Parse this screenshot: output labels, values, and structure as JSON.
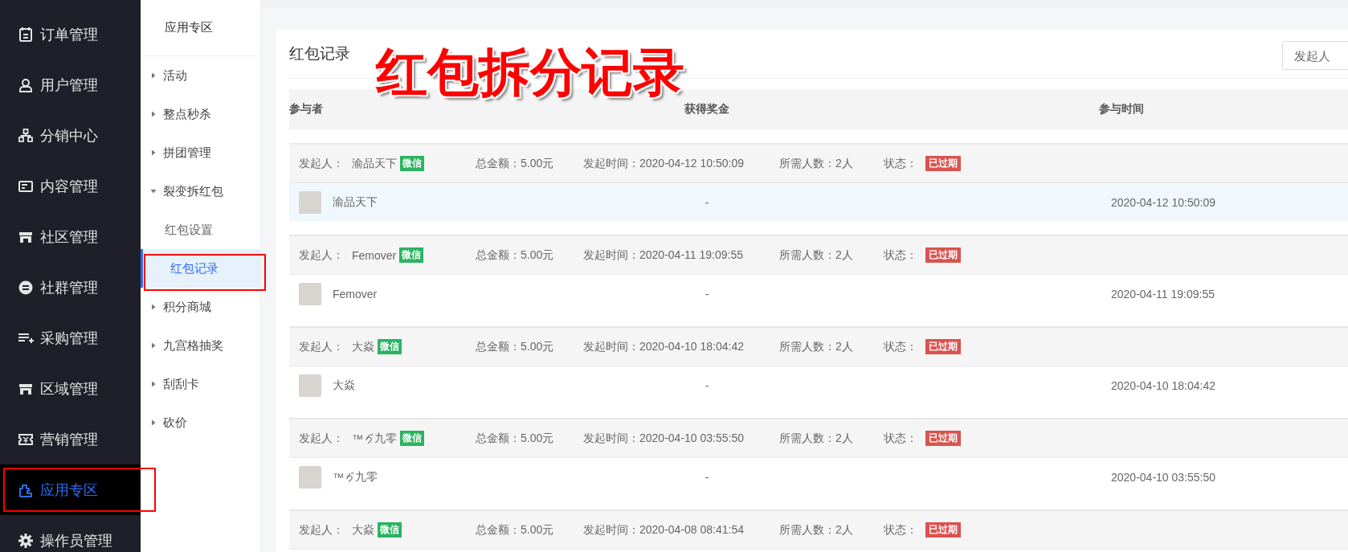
{
  "sidebar": {
    "items": [
      {
        "label": "订单管理",
        "selected": false,
        "callout": false
      },
      {
        "label": "用户管理",
        "selected": false,
        "callout": false
      },
      {
        "label": "分销中心",
        "selected": false,
        "callout": false
      },
      {
        "label": "内容管理",
        "selected": false,
        "callout": false
      },
      {
        "label": "社区管理",
        "selected": false,
        "callout": false
      },
      {
        "label": "社群管理",
        "selected": false,
        "callout": false
      },
      {
        "label": "采购管理",
        "selected": false,
        "callout": false
      },
      {
        "label": "区域管理",
        "selected": false,
        "callout": false
      },
      {
        "label": "营销管理",
        "selected": false,
        "callout": false
      },
      {
        "label": "应用专区",
        "selected": true,
        "callout": true
      },
      {
        "label": "操作员管理",
        "selected": false,
        "callout": false
      }
    ]
  },
  "submenu": {
    "title": "应用专区",
    "items": [
      {
        "label": "活动",
        "expanded": false
      },
      {
        "label": "整点秒杀",
        "expanded": false
      },
      {
        "label": "拼团管理",
        "expanded": false
      },
      {
        "label": "裂变拆红包",
        "expanded": true,
        "children": [
          {
            "label": "红包设置",
            "selected": false,
            "callout": false
          },
          {
            "label": "红包记录",
            "selected": true,
            "callout": true
          }
        ]
      },
      {
        "label": "积分商城",
        "expanded": false
      },
      {
        "label": "九宫格抽奖",
        "expanded": false
      },
      {
        "label": "刮刮卡",
        "expanded": false
      },
      {
        "label": "砍价",
        "expanded": false
      }
    ]
  },
  "page": {
    "title": "红包记录",
    "annotation": "红包拆分记录",
    "search": {
      "placeholder": "发起人"
    }
  },
  "table": {
    "columns": [
      "参与者",
      "获得奖金",
      "参与时间"
    ],
    "groups": [
      {
        "initiator_label": "发起人：",
        "initiator": "渝品天下",
        "channel": "微信",
        "total": "总金额：5.00元",
        "started": "发起时间：2020-04-12 10:50:09",
        "required": "所需人数：2人",
        "status_label": "状态：",
        "status": "已过期",
        "participants": [
          {
            "name": "渝品天下",
            "prize": "-",
            "time": "2020-04-12 10:50:09",
            "highlighted": true
          }
        ]
      },
      {
        "initiator_label": "发起人：",
        "initiator": "Femover",
        "channel": "微信",
        "total": "总金额：5.00元",
        "started": "发起时间：2020-04-11 19:09:55",
        "required": "所需人数：2人",
        "status_label": "状态：",
        "status": "已过期",
        "participants": [
          {
            "name": "Femover",
            "prize": "-",
            "time": "2020-04-11 19:09:55",
            "highlighted": false
          }
        ]
      },
      {
        "initiator_label": "发起人：",
        "initiator": "大焱",
        "channel": "微信",
        "total": "总金额：5.00元",
        "started": "发起时间：2020-04-10 18:04:42",
        "required": "所需人数：2人",
        "status_label": "状态：",
        "status": "已过期",
        "participants": [
          {
            "name": "大焱",
            "prize": "-",
            "time": "2020-04-10 18:04:42",
            "highlighted": false
          }
        ]
      },
      {
        "initiator_label": "发起人：",
        "initiator_segments": [
          {
            "kind": "text",
            "text": "™"
          },
          {
            "kind": "glyph"
          },
          {
            "kind": "text",
            "text": "九零"
          }
        ],
        "channel": "微信",
        "total": "总金额：5.00元",
        "started": "发起时间：2020-04-10 03:55:50",
        "required": "所需人数：2人",
        "status_label": "状态：",
        "status": "已过期",
        "participants": [
          {
            "name_segments": [
              {
                "kind": "text",
                "text": "™"
              },
              {
                "kind": "glyph"
              },
              {
                "kind": "text",
                "text": "九零"
              }
            ],
            "prize": "-",
            "time": "2020-04-10 03:55:50",
            "highlighted": false
          }
        ]
      },
      {
        "initiator_label": "发起人：",
        "initiator": "大焱",
        "channel": "微信",
        "total": "总金额：5.00元",
        "started": "发起时间：2020-04-08 08:41:54",
        "required": "所需人数：2人",
        "status_label": "状态：",
        "status": "已过期"
      }
    ]
  }
}
